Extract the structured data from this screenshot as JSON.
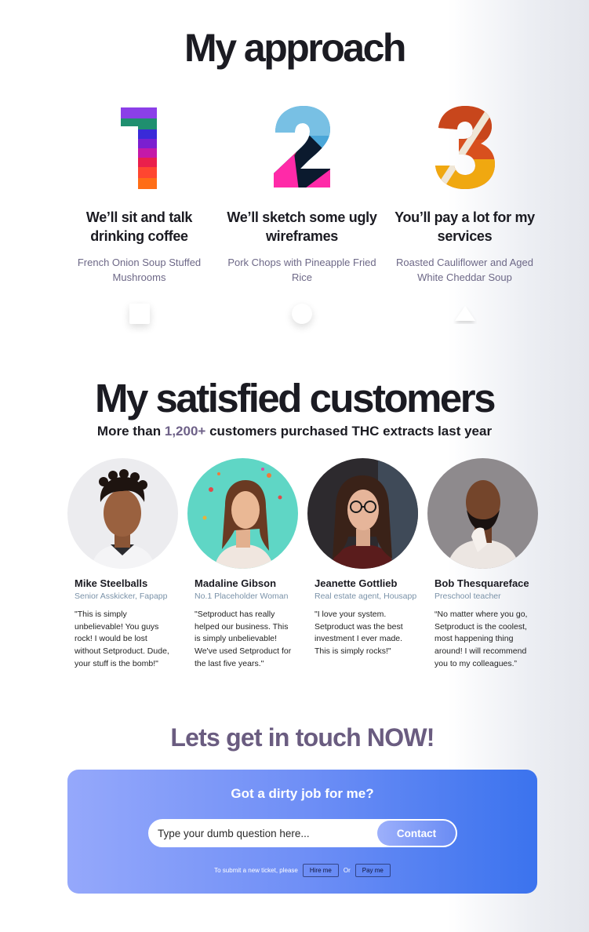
{
  "approach": {
    "title": "My approach",
    "steps": [
      {
        "number": "1",
        "title": "We’ll sit and talk drinking coffee",
        "subtitle": "French Onion Soup Stuffed Mushrooms",
        "shape": "square"
      },
      {
        "number": "2",
        "title": "We’ll sketch some ugly wireframes",
        "subtitle": "Pork Chops with Pineapple Fried Rice",
        "shape": "circle"
      },
      {
        "number": "3",
        "title": "You’ll pay a lot for my services",
        "subtitle": "Roasted Cauliflower and Aged White Cheddar Soup",
        "shape": "triangle"
      }
    ]
  },
  "customers": {
    "title": "My satisfied customers",
    "subtitle_before": "More than ",
    "subtitle_highlight": "1,200+",
    "subtitle_after": " customers purchased THC extracts last year",
    "highlight_color": "#6e6188",
    "people": [
      {
        "name": "Mike Steelballs",
        "role": "Senior Asskicker, Fapapp",
        "quote": "\"This is simply unbelievable! You guys rock! I would be lost without Setproduct. Dude, your stuff is the bomb!\""
      },
      {
        "name": "Madaline Gibson",
        "role": "No.1 Placeholder Woman",
        "quote": "\"Setproduct has really helped our business. This is simply unbelievable! We've used Setproduct for the last five years.\""
      },
      {
        "name": "Jeanette Gottlieb",
        "role": "Real estate agent, Housapp",
        "quote": "\"I love your system. Setproduct was the best investment I ever made. This is simply rocks!\""
      },
      {
        "name": "Bob Thesquareface",
        "role": "Preschool teacher",
        "quote": "“No matter where you go, Setproduct is the coolest, most happening thing around! I will recommend you to my colleagues.”"
      }
    ]
  },
  "contact": {
    "title": "Lets get in touch NOW!",
    "card_title": "Got a dirty job for me?",
    "input_placeholder": "Type your dumb question here...",
    "button_label": "Contact",
    "ticket_text": "To submit a new ticket, please",
    "hire_label": "Hire me",
    "or_text": "Or",
    "pay_label": "Pay me"
  }
}
